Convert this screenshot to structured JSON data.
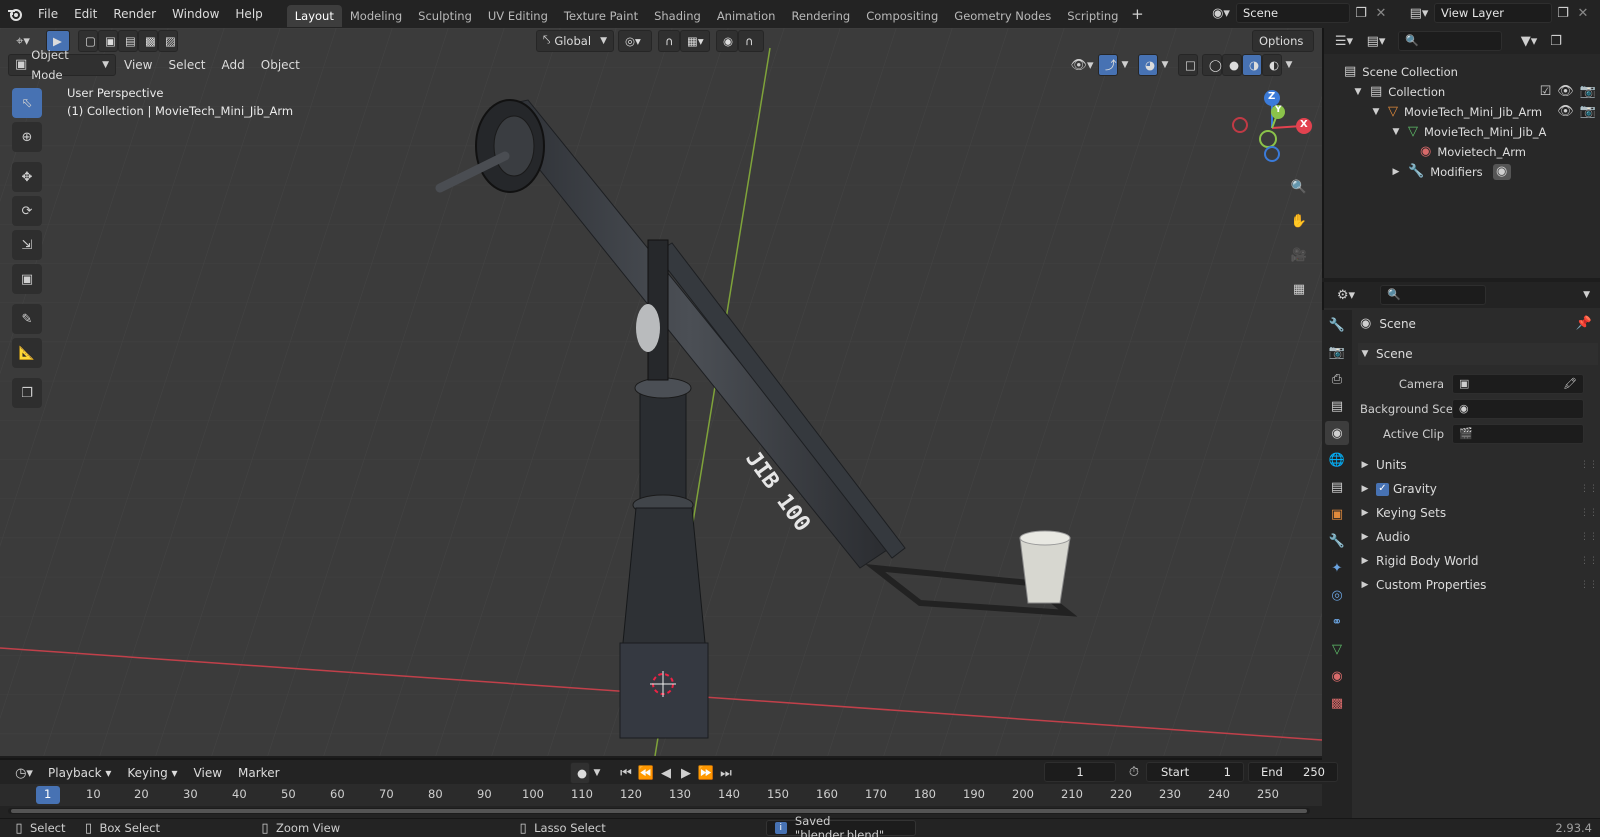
{
  "topbar": {
    "menus": [
      "File",
      "Edit",
      "Render",
      "Window",
      "Help"
    ],
    "workspaces": [
      "Layout",
      "Modeling",
      "Sculpting",
      "UV Editing",
      "Texture Paint",
      "Shading",
      "Animation",
      "Rendering",
      "Compositing",
      "Geometry Nodes",
      "Scripting"
    ],
    "active_workspace": "Layout",
    "scene_name": "Scene",
    "view_layer": "View Layer"
  },
  "viewport": {
    "mode": "Object Mode",
    "menus": [
      "View",
      "Select",
      "Add",
      "Object"
    ],
    "transform_orientation": "Global",
    "options_label": "Options",
    "overlay_title": "User Perspective",
    "overlay_subtitle": "(1) Collection | MovieTech_Mini_Jib_Arm",
    "jib_label": "JIB 100",
    "gizmo": {
      "x": "X",
      "y": "Y",
      "z": "Z"
    }
  },
  "outliner": {
    "rows": [
      {
        "label": "Scene Collection"
      },
      {
        "label": "Collection"
      },
      {
        "label": "MovieTech_Mini_Jib_Arm"
      },
      {
        "label": "MovieTech_Mini_Jib_A"
      },
      {
        "label": "Movietech_Arm"
      },
      {
        "label": "Modifiers"
      }
    ]
  },
  "properties": {
    "context": "Scene",
    "section": "Scene",
    "fields": [
      {
        "label": "Camera",
        "value": ""
      },
      {
        "label": "Background Sce...",
        "value": ""
      },
      {
        "label": "Active Clip",
        "value": ""
      }
    ],
    "panels": [
      "Units",
      "Gravity",
      "Keying Sets",
      "Audio",
      "Rigid Body World",
      "Custom Properties"
    ],
    "gravity_checked": true
  },
  "timeline": {
    "menus": [
      "Playback",
      "Keying",
      "View",
      "Marker"
    ],
    "current_frame": "1",
    "start_label": "Start",
    "start_value": "1",
    "end_label": "End",
    "end_value": "250",
    "ticks": [
      "1",
      "10",
      "20",
      "30",
      "40",
      "50",
      "60",
      "70",
      "80",
      "90",
      "100",
      "110",
      "120",
      "130",
      "140",
      "150",
      "160",
      "170",
      "180",
      "190",
      "200",
      "210",
      "220",
      "230",
      "240",
      "250"
    ]
  },
  "status": {
    "select": "Select",
    "box_select": "Box Select",
    "zoom_view": "Zoom View",
    "lasso_select": "Lasso Select",
    "message": "Saved \"blender.blend\"",
    "version": "2.93.4"
  },
  "colors": {
    "accent": "#4772b3",
    "x_axis": "#e2424f",
    "y_axis": "#8bc34a",
    "z_axis": "#3b7bd9"
  }
}
